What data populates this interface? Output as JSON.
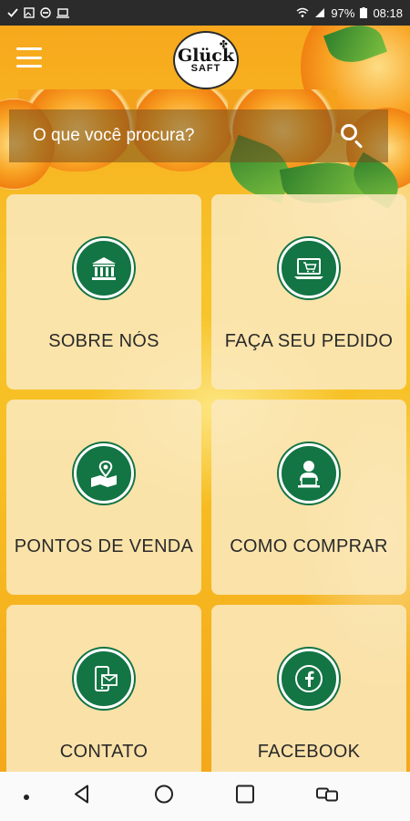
{
  "status_bar": {
    "battery": "97%",
    "time": "08:18"
  },
  "header": {
    "logo_main": "Glück",
    "logo_sub": "SAFT"
  },
  "search": {
    "placeholder": "O que você procura?"
  },
  "tiles": [
    {
      "label": "SOBRE NÓS",
      "icon": "bank-icon"
    },
    {
      "label": "FAÇA SEU PEDIDO",
      "icon": "laptop-cart-icon"
    },
    {
      "label": "PONTOS DE VENDA",
      "icon": "map-pin-icon"
    },
    {
      "label": "COMO COMPRAR",
      "icon": "person-computer-icon"
    },
    {
      "label": "CONTATO",
      "icon": "phone-mail-icon"
    },
    {
      "label": "FACEBOOK",
      "icon": "facebook-icon"
    }
  ],
  "colors": {
    "accent_green": "#137444",
    "background_orange": "#f6b81a",
    "tile_background": "#fbe8bc"
  }
}
